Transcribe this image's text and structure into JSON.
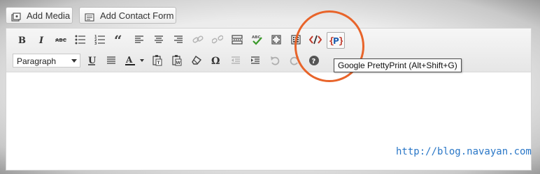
{
  "media_buttons": {
    "add_media_label": "Add Media",
    "add_contact_form_label": "Add Contact Form"
  },
  "toolbar": {
    "row1": [
      "bold-icon",
      "italic-icon",
      "strikethrough-icon",
      "bullet-list-icon",
      "numbered-list-icon",
      "blockquote-icon",
      "align-left-icon",
      "align-center-icon",
      "align-right-icon",
      "insert-link-icon",
      "unlink-icon",
      "insert-more-icon",
      "spellcheck-icon",
      "fullscreen-icon",
      "toolbar-toggle-icon",
      "code-icon",
      "prettyprint-icon"
    ],
    "row2": [
      "underline-icon",
      "justify-icon",
      "text-color-icon",
      "paste-text-icon",
      "paste-word-icon",
      "clear-formatting-icon",
      "special-character-icon",
      "outdent-icon",
      "indent-icon",
      "undo-icon",
      "redo-icon",
      "help-icon"
    ]
  },
  "format_select": {
    "value": "Paragraph"
  },
  "tooltip": {
    "text": "Google PrettyPrint (Alt+Shift+G)"
  },
  "watermark": {
    "text": "http://blog.navayan.com"
  },
  "colors": {
    "highlight_ring": "#e8642a",
    "code_icon_red": "#c0392b",
    "prettyprint_blue": "#1f5fb0",
    "watermark": "#2a77c7",
    "spellcheck_green": "#3a9a2a"
  }
}
